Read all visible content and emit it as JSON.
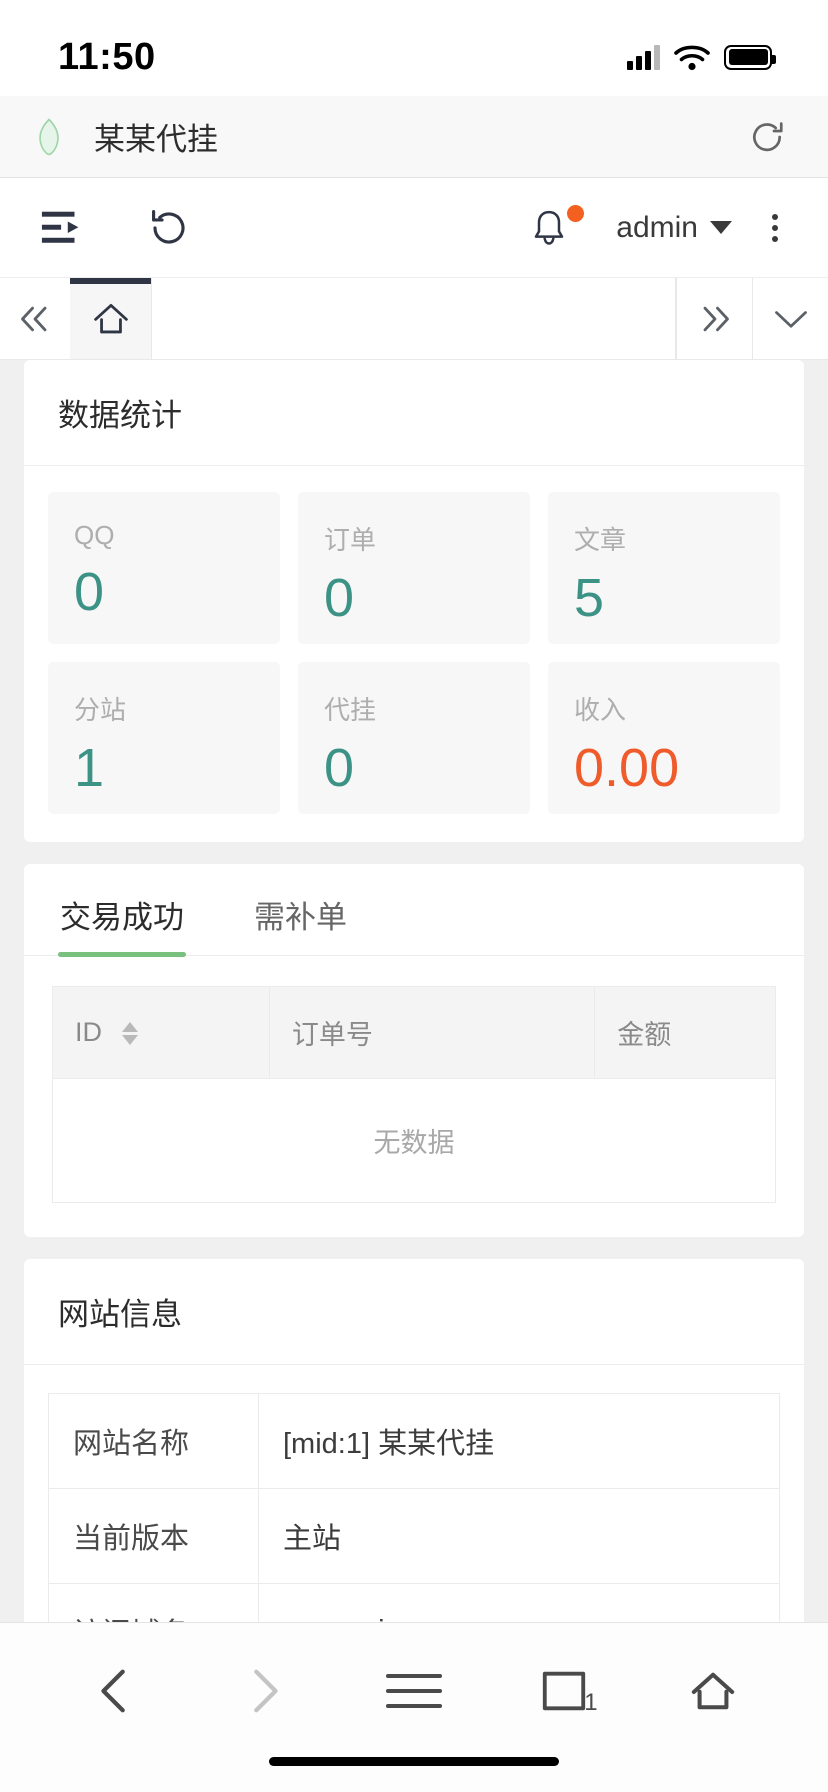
{
  "status_bar": {
    "time": "11:50",
    "signal_icon": "cellular-signal-icon",
    "wifi_icon": "wifi-icon",
    "battery_icon": "battery-icon"
  },
  "browser_bar": {
    "shield_icon": "shield-icon",
    "site_title": "某某代挂",
    "reload_icon": "reload-icon"
  },
  "admin_bar": {
    "menu_toggle_icon": "menu-indent-icon",
    "refresh_icon": "refresh-icon",
    "bell_icon": "bell-icon",
    "notification_dot_color": "#f4601f",
    "username": "admin",
    "dropdown_icon": "caret-down-icon",
    "more_icon": "kebab-menu-icon"
  },
  "tab_strip": {
    "prev_icon": "double-chevron-left-icon",
    "next_icon": "double-chevron-right-icon",
    "dropdown_icon": "chevron-down-icon",
    "tabs": [
      {
        "icon": "home-icon",
        "active": true
      }
    ]
  },
  "stats_card": {
    "title": "数据统计",
    "items": [
      {
        "label": "QQ",
        "value": "0",
        "accent": false
      },
      {
        "label": "订单",
        "value": "0",
        "accent": false
      },
      {
        "label": "文章",
        "value": "5",
        "accent": false
      },
      {
        "label": "分站",
        "value": "1",
        "accent": false
      },
      {
        "label": "代挂",
        "value": "0",
        "accent": false
      },
      {
        "label": "收入",
        "value": "0.00",
        "accent": true
      }
    ],
    "value_color": "#3c9285",
    "accent_color": "#ef5b2b"
  },
  "orders_card": {
    "tabs": [
      {
        "label": "交易成功",
        "active": true
      },
      {
        "label": "需补单",
        "active": false
      }
    ],
    "active_underline_color": "#7ac07f",
    "table": {
      "columns": [
        "ID",
        "订单号",
        "金额"
      ],
      "sortable_column": "ID",
      "rows": [],
      "empty_text": "无数据"
    }
  },
  "site_info_card": {
    "title": "网站信息",
    "rows": [
      {
        "key": "网站名称",
        "value": "[mid:1] 某某代挂",
        "style": "plain"
      },
      {
        "key": "当前版本",
        "value": "主站",
        "style": "red"
      },
      {
        "key": "访问域名",
        "value": "cos.roui.cn",
        "style": "link"
      }
    ]
  },
  "bottom_nav": {
    "items": [
      {
        "icon": "back-chevron-icon",
        "label": ""
      },
      {
        "icon": "forward-chevron-icon",
        "label": ""
      },
      {
        "icon": "hamburger-menu-icon",
        "label": ""
      },
      {
        "icon": "tabs-square-icon",
        "label": "1"
      },
      {
        "icon": "home-outline-icon",
        "label": ""
      }
    ]
  }
}
